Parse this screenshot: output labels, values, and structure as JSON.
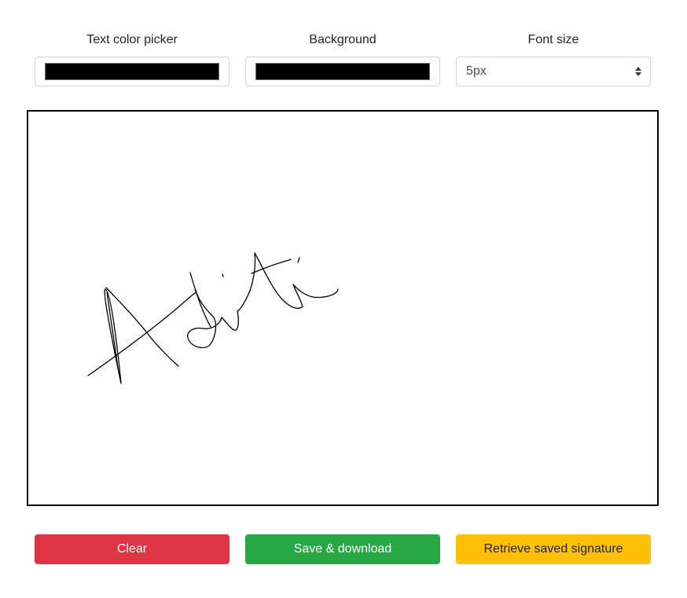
{
  "controls": {
    "text_color": {
      "label": "Text color picker",
      "value": "#000000"
    },
    "background": {
      "label": "Background",
      "value": "#000000"
    },
    "font_size": {
      "label": "Font size",
      "selected": "5px"
    }
  },
  "canvas": {
    "background": "#ffffff",
    "border_color": "#000000",
    "stroke_color": "#000000"
  },
  "buttons": {
    "clear": {
      "label": "Clear",
      "color": "#dc3545",
      "text_color": "#ffffff"
    },
    "save": {
      "label": "Save & download",
      "color": "#28a745",
      "text_color": "#ffffff"
    },
    "retrieve": {
      "label": "Retrieve saved signature",
      "color": "#ffc107",
      "text_color": "#212529"
    }
  }
}
